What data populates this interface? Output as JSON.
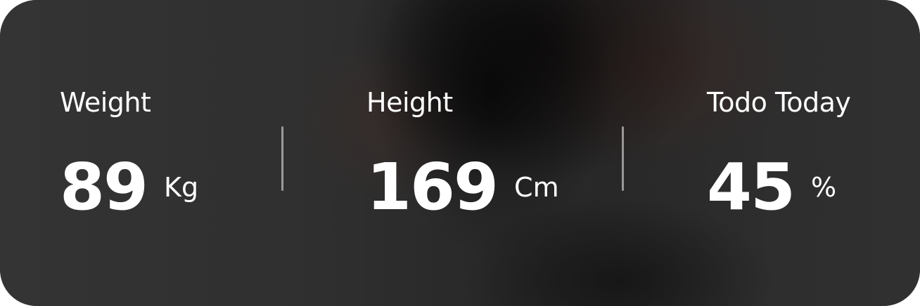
{
  "stats": [
    {
      "label": "Weight",
      "value": "89",
      "unit": "Kg"
    },
    {
      "label": "Height",
      "value": "169",
      "unit": "Cm"
    },
    {
      "label": "Todo Today",
      "value": "45",
      "unit": "%"
    }
  ],
  "colors": {
    "card_background": "#2f2f2f",
    "text": "#ffffff",
    "divider": "#c8c8c8"
  }
}
